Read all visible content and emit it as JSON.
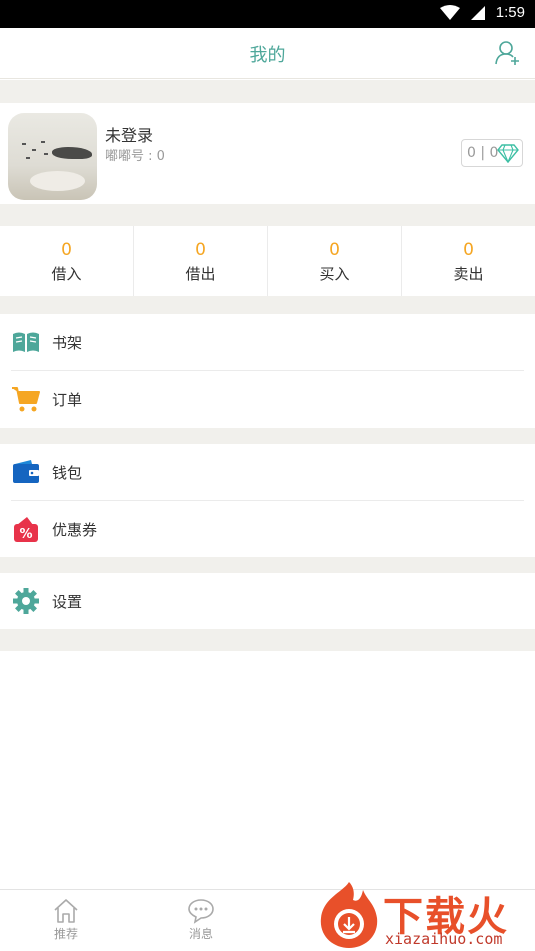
{
  "status_bar": {
    "time": "1:59",
    "icons": [
      "wifi-icon",
      "cell-signal-icon"
    ]
  },
  "header": {
    "title": "我的",
    "right_icon": "add-user-icon"
  },
  "profile": {
    "name": "未登录",
    "id_text": "嘟嘟号 : 0",
    "gem_text": "0 | 0",
    "gem_icon": "diamond-icon"
  },
  "stats": [
    {
      "value": "0",
      "label": "借入"
    },
    {
      "value": "0",
      "label": "借出"
    },
    {
      "value": "0",
      "label": "买入"
    },
    {
      "value": "0",
      "label": "卖出"
    }
  ],
  "menu_groups": [
    {
      "items": [
        {
          "label": "书架",
          "icon": "book-icon"
        },
        {
          "label": "订单",
          "icon": "cart-icon"
        }
      ]
    },
    {
      "items": [
        {
          "label": "钱包",
          "icon": "wallet-icon"
        },
        {
          "label": "优惠券",
          "icon": "coupon-icon"
        }
      ]
    },
    {
      "items": [
        {
          "label": "设置",
          "icon": "gear-icon"
        }
      ]
    }
  ],
  "tabbar": [
    {
      "label": "推荐",
      "icon": "home-icon"
    },
    {
      "label": "消息",
      "icon": "chat-icon"
    }
  ],
  "watermark": {
    "text": "下载火",
    "url": "xiazaihuo.com"
  },
  "colors": {
    "accent": "#4ea79a",
    "number": "#f5a623",
    "background_gap": "#f1f0ec"
  }
}
